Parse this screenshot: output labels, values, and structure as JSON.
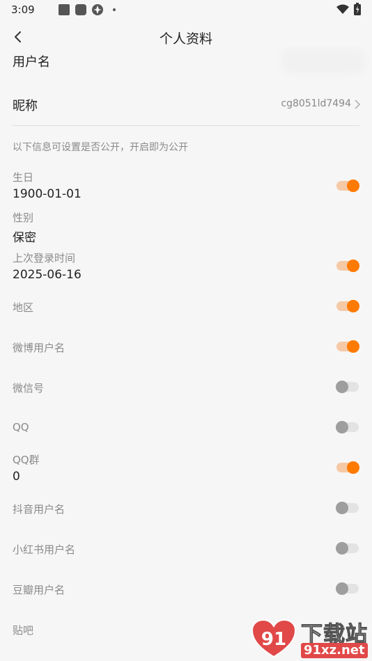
{
  "status_bar": {
    "time": "3:09"
  },
  "header": {
    "title": "个人资料"
  },
  "username_row": {
    "label": "用户名"
  },
  "nickname_row": {
    "label": "昵称",
    "value": "cg8051ld7494"
  },
  "notice": "以下信息可设置是否公开，开启即为公开",
  "colors": {
    "accent": "#ff7a00",
    "toggle_off": "#9e9e9e",
    "background": "#f6f6f6"
  },
  "fields": [
    {
      "label": "生日",
      "value": "1900-01-01",
      "public": true
    },
    {
      "label": "性别",
      "value": "保密"
    },
    {
      "label": "上次登录时间",
      "value": "2025-06-16",
      "public": true
    },
    {
      "label": "地区",
      "public": true
    },
    {
      "label": "微博用户名",
      "public": true
    },
    {
      "label": "微信号",
      "public": false
    },
    {
      "label": "QQ",
      "public": false
    },
    {
      "label": "QQ群",
      "value": "0",
      "public": true
    },
    {
      "label": "抖音用户名",
      "public": false
    },
    {
      "label": "小红书用户名",
      "public": false
    },
    {
      "label": "豆瓣用户名",
      "public": false
    },
    {
      "label": "贴吧"
    }
  ],
  "watermark": {
    "title": "下载站",
    "url": "91xz.net",
    "badge_text": "91"
  }
}
